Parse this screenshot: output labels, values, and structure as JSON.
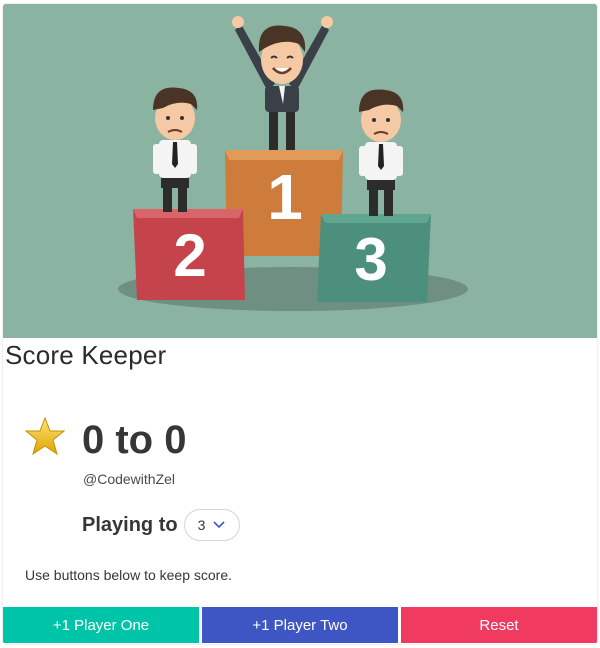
{
  "app": {
    "title": "Score Keeper",
    "score_display": "0 to 0",
    "handle": "@CodewithZel",
    "playing_to_label": "Playing to",
    "selected_winning_score": "3",
    "instructions": "Use buttons below to keep score."
  },
  "podium": {
    "first_place": "1",
    "second_place": "2",
    "third_place": "3"
  },
  "buttons": {
    "player_one": "+1 Player One",
    "player_two": "+1 Player Two",
    "reset": "Reset"
  },
  "colors": {
    "player_one": "#00c4a7",
    "player_two": "#3e56c4",
    "reset": "#f03a5f",
    "hero_background": "#8ab4a1"
  },
  "icons": {
    "star": "star-icon",
    "dropdown": "chevron-down-icon"
  }
}
